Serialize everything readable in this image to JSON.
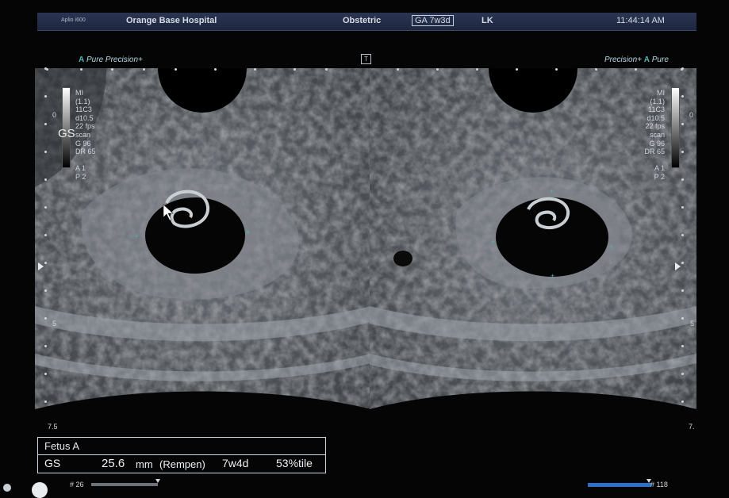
{
  "header": {
    "model": "Aplio i600",
    "hospital": "Orange Base Hospital",
    "exam": "Obstetric",
    "ga": "GA 7w3d",
    "operator": "LK",
    "time": "11:44:14 AM"
  },
  "presets": {
    "left_prefix": "A",
    "left_rest": "Pure Precision+",
    "right_main": "Precision+",
    "right_prefix": "A",
    "right_rest": "Pure"
  },
  "params": {
    "left": [
      "MI",
      "(1.1)",
      "11C3",
      "d10.5",
      "22 fps",
      "scan",
      "G 96",
      "DR 65",
      "",
      "A 1",
      "P 2"
    ],
    "right": [
      "MI",
      "(1.1)",
      "11C3",
      "d10.5",
      "22 fps",
      "scan",
      "G 96",
      "DR 65",
      "",
      "A 1",
      "P 2"
    ]
  },
  "gs_tag": "GS",
  "depth": {
    "left_top": "0",
    "left_mid": "5",
    "left_bottom": "7.5",
    "right_top": "0",
    "right_mid": "5",
    "right_bottom": "7."
  },
  "measurement": {
    "title": "Fetus A",
    "label": "GS",
    "value": "25.6",
    "unit": "mm",
    "method": "(Rempen)",
    "ga": "7w4d",
    "percentile": "53%tile"
  },
  "frames": {
    "left": "# 26",
    "right": "# 118"
  },
  "colors": {
    "header_bg": "#2b3552",
    "accent_teal": "#4fb3b8",
    "cine_bar": "#2d6fc9"
  }
}
